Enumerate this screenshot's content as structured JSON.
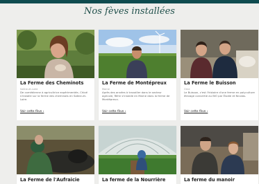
{
  "section": {
    "title": "Nos fèves installées"
  },
  "colors": {
    "header_bar": "#0f4b4f",
    "title": "#1f4f4a",
    "page_bg": "#eeeeec"
  },
  "farms": [
    {
      "name": "La Ferme des Cheminots",
      "place": "Saône-et-Loire",
      "description": "De comédienne à agricultrice expérimentée, Chloé s'installe sur la ferme des cheminots en Saône-et-Loire.",
      "link": "Voir cette fève"
    },
    {
      "name": "La Ferme de Montépreux",
      "place": "Marne",
      "description": "Après des années à travailler dans le secteur agricole, Rémi s'installe en Marne dans la ferme de Montépreux.",
      "link": "Voir cette fève"
    },
    {
      "name": "La Ferme le Buisson",
      "place": "Orne",
      "description": "Le Buisson, c'est l'histoire d'une ferme en polyculture élevage convertie au BIO par Élodie et Nicolas.",
      "link": "Voir cette fève"
    },
    {
      "name": "La Ferme de l'Aufraicie"
    },
    {
      "name": "La ferme de la Nourrière"
    },
    {
      "name": "La ferme du manoir"
    }
  ]
}
